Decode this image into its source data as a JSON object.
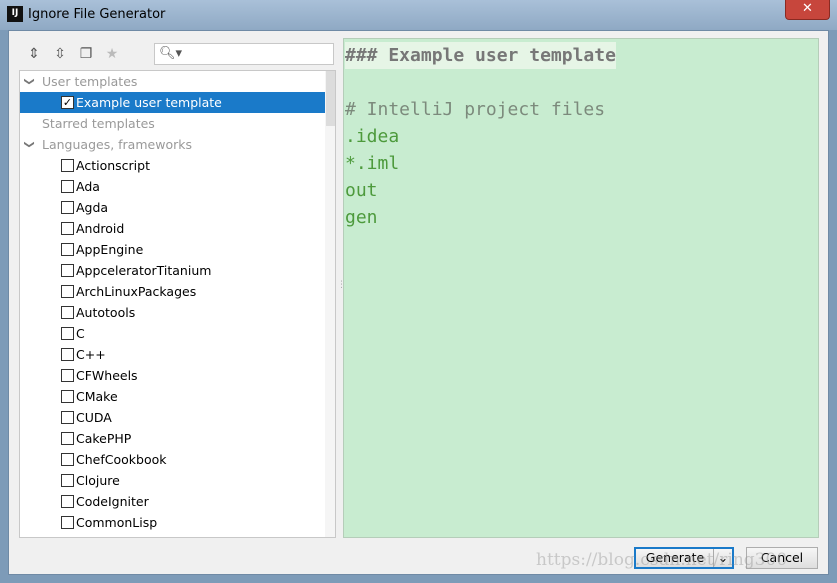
{
  "window": {
    "title": "Ignore File Generator",
    "app_icon": "IJ",
    "close": "✕"
  },
  "toolbar": {
    "expand_icon": "expand-all-icon",
    "collapse_icon": "collapse-all-icon",
    "copy_icon": "copy-icon",
    "star_icon": "star-icon",
    "search_placeholder": ""
  },
  "tree": {
    "groups": [
      {
        "label": "User templates",
        "expanded": true
      },
      {
        "label": "Starred templates",
        "expanded": false
      },
      {
        "label": "Languages, frameworks",
        "expanded": true
      }
    ],
    "user_templates": [
      {
        "label": "Example user template",
        "checked": true,
        "selected": true
      }
    ],
    "languages": [
      "Actionscript",
      "Ada",
      "Agda",
      "Android",
      "AppEngine",
      "AppceleratorTitanium",
      "ArchLinuxPackages",
      "Autotools",
      "C",
      "C++",
      "CFWheels",
      "CMake",
      "CUDA",
      "CakePHP",
      "ChefCookbook",
      "Clojure",
      "CodeIgniter",
      "CommonLisp"
    ]
  },
  "editor": {
    "lines": [
      "### Example user template",
      "",
      "# IntelliJ project files",
      ".idea",
      "*.iml",
      "out",
      "gen"
    ]
  },
  "buttons": {
    "generate": "Generate",
    "cancel": "Cancel"
  },
  "watermark": "https://blog.csdn.net/ring300"
}
